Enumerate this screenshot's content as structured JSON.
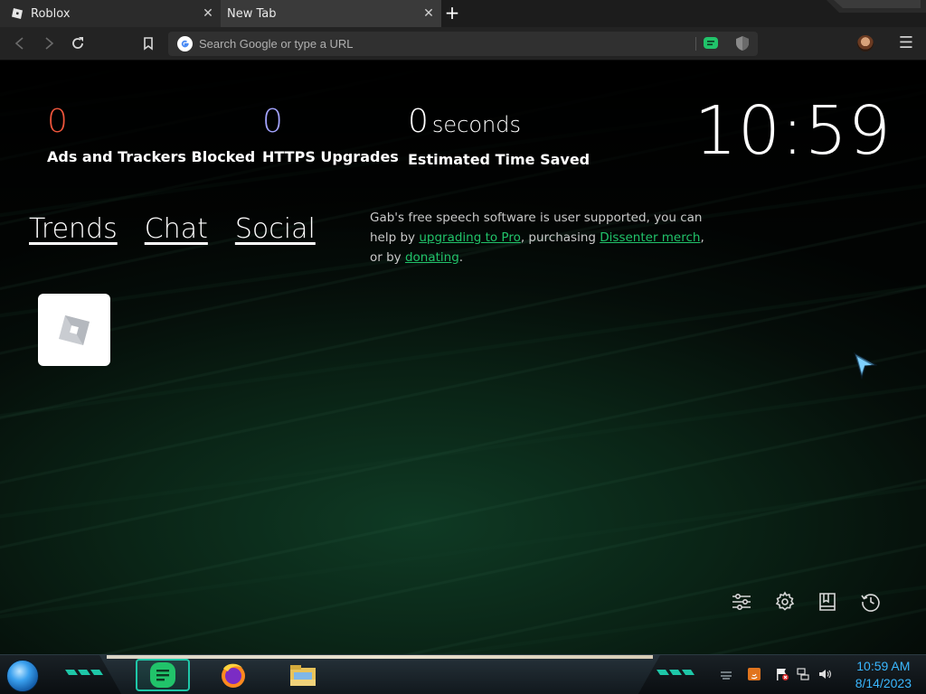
{
  "tabs": [
    {
      "title": "Roblox",
      "close": "✕"
    },
    {
      "title": "New Tab",
      "close": "✕"
    }
  ],
  "new_tab_glyph": "+",
  "toolbar": {
    "back_icon": "back-arrow-icon",
    "forward_icon": "forward-arrow-icon",
    "reload_icon": "reload-icon",
    "bookmark_icon": "bookmark-icon",
    "omnibox_placeholder": "Search Google or type a URL",
    "menu_glyph": "☰"
  },
  "stats": {
    "ads_blocked": {
      "value": "0",
      "label": "Ads and Trackers Blocked",
      "color": "#f0563c"
    },
    "https_upgrades": {
      "value": "0",
      "label": "HTTPS Upgrades",
      "color": "#a3a4ff"
    },
    "time_saved": {
      "value": "0",
      "unit": "seconds",
      "label": "Estimated Time Saved",
      "color": "#ffffff"
    }
  },
  "clock": "10:59",
  "links": [
    "Trends",
    "Chat",
    "Social"
  ],
  "gab_message": {
    "part1": "Gab's free speech software is user supported, you can help by ",
    "link1": "upgrading to Pro",
    "part2": ", purchasing ",
    "link2": "Dissenter merch",
    "part3": ", or by ",
    "link3": "donating",
    "part4": "."
  },
  "top_site_tile": {
    "name": "Roblox"
  },
  "bottom_icons": [
    "customize-sliders-icon",
    "settings-gear-icon",
    "bookmarks-icon",
    "history-icon"
  ],
  "taskbar": {
    "time": "10:59 AM",
    "date": "8/14/2023",
    "accent": "#1ec7a8"
  }
}
